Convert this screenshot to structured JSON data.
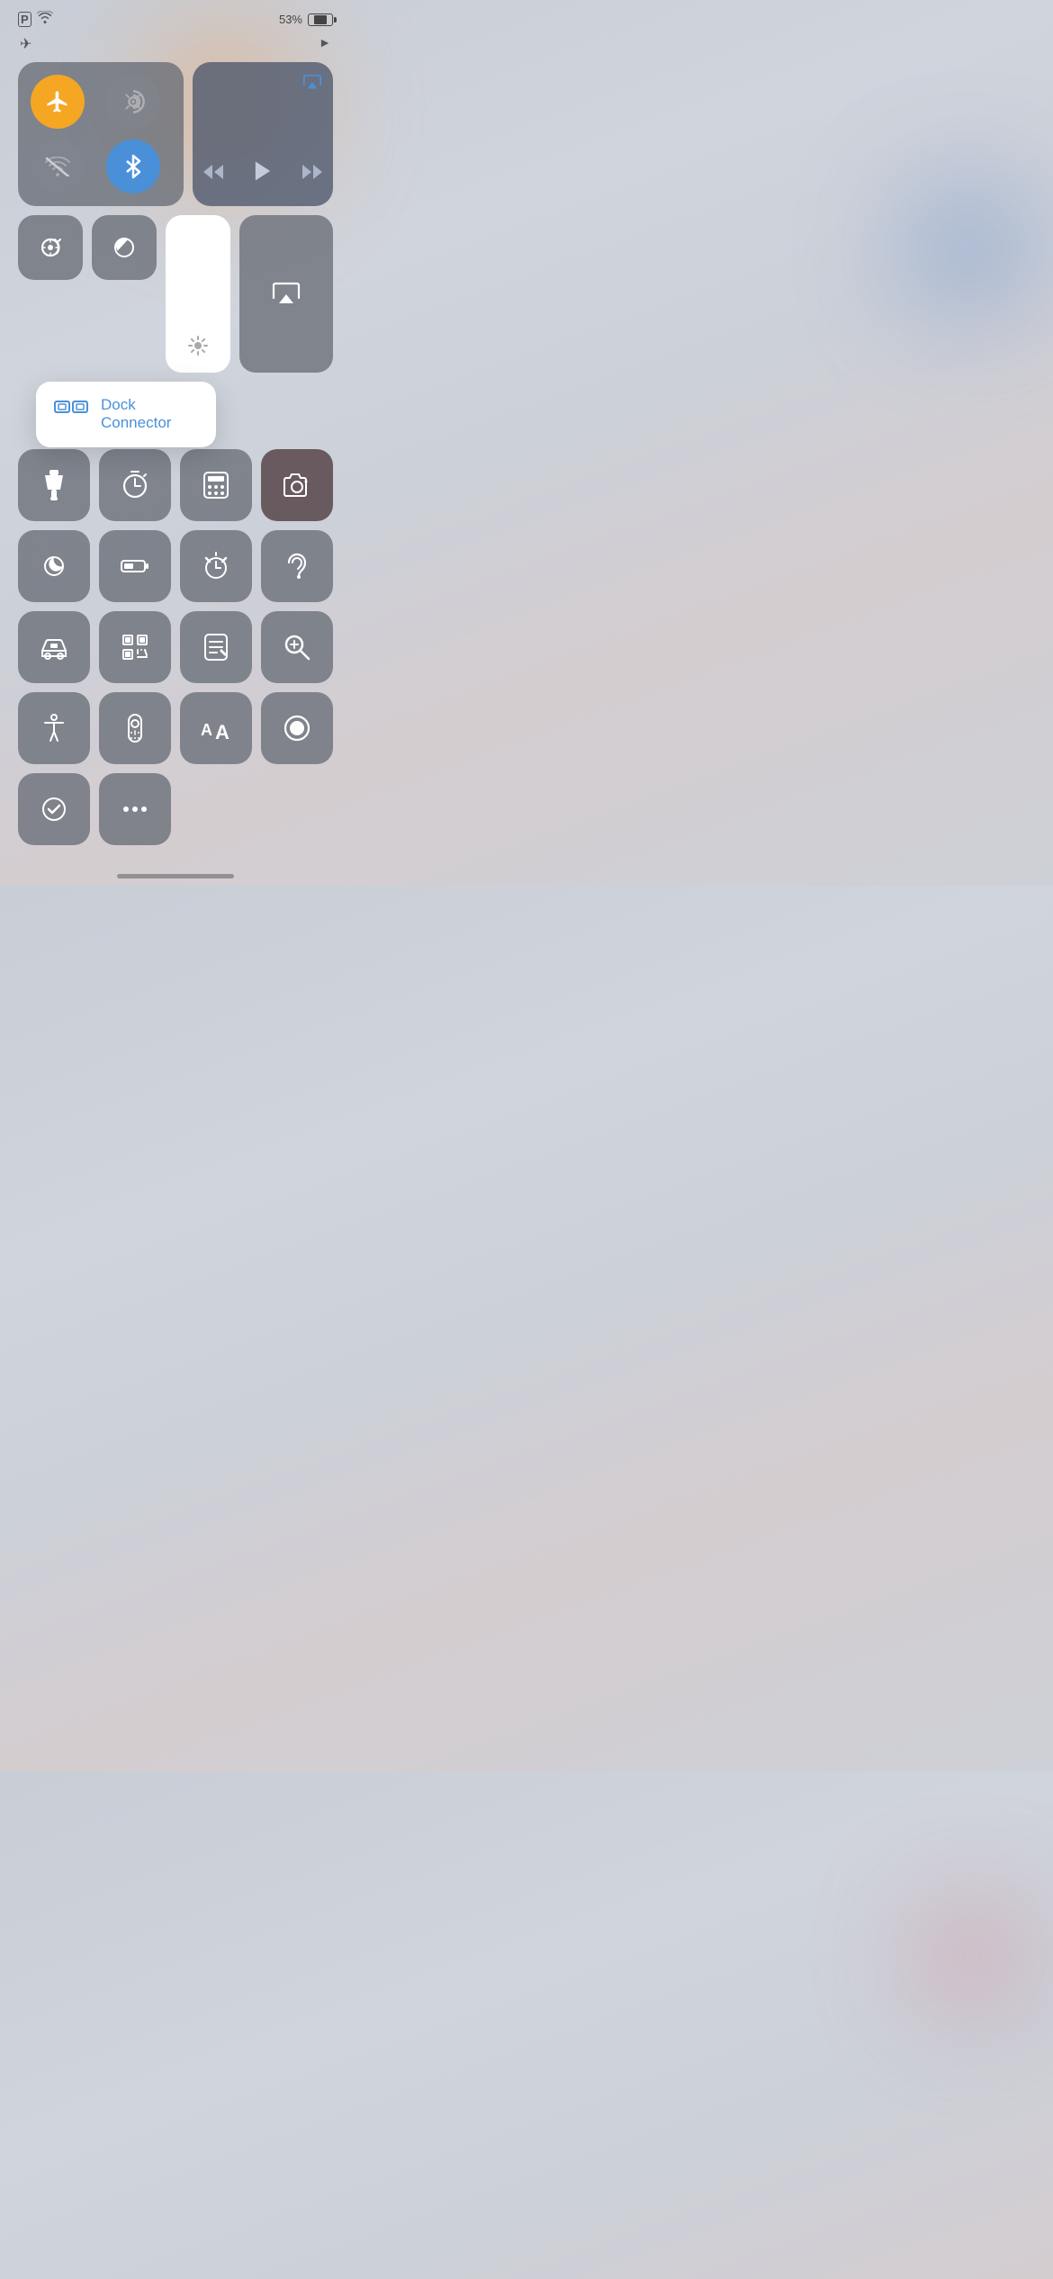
{
  "statusBar": {
    "batteryPercent": "53%",
    "icons": {
      "parking": "P",
      "wifi": "wifi",
      "airplane": "✈",
      "location": "▶"
    }
  },
  "connectivity": {
    "airplaneMode": true,
    "cellular": false,
    "wifi": false,
    "bluetooth": true
  },
  "media": {
    "airplayIcon": "airplay",
    "rewindLabel": "⏮",
    "playLabel": "▶",
    "fastforwardLabel": "⏭"
  },
  "controls": {
    "rotation_lock_label": "rotation-lock",
    "do_not_disturb_label": "do-not-disturb",
    "brightness_label": "brightness",
    "airplay_label": "airplay",
    "flashlight_label": "flashlight",
    "timer_label": "timer",
    "calculator_label": "calculator",
    "camera_label": "camera"
  },
  "dockConnector": {
    "label": "Dock Connector",
    "iconType": "dock-connector-icon"
  },
  "grid2": {
    "darkmode_label": "dark-mode",
    "battery_label": "battery",
    "alarm_label": "alarm",
    "hearing_label": "hearing"
  },
  "grid3": {
    "carplay_label": "carplay",
    "scanner_label": "code-scanner",
    "notes_label": "notes",
    "magnifier_label": "magnifier"
  },
  "grid4": {
    "accessibility_label": "accessibility",
    "remote_label": "apple-tv-remote",
    "text_size_label": "text-size",
    "record_label": "screen-record"
  },
  "partial": {
    "item1": "item1",
    "item2": "item2"
  }
}
